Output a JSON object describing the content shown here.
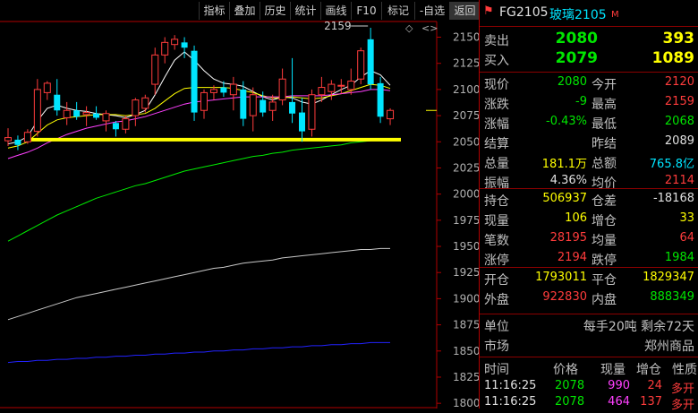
{
  "toolbar": {
    "buttons": [
      "指标",
      "叠加",
      "历史",
      "统计",
      "画线",
      "F10",
      "标记",
      "-自选",
      "返回"
    ]
  },
  "chart_data": {
    "type": "candlestick",
    "ylim": [
      1795,
      2165
    ],
    "y_ticks": [
      2150,
      2125,
      2100,
      2075,
      2050,
      2025,
      2000,
      1975,
      1950,
      1925,
      1900,
      1875,
      1850,
      1825,
      1800
    ],
    "candles": [
      {
        "o": 2051,
        "h": 2063,
        "l": 2046,
        "c": 2054,
        "dir": "up"
      },
      {
        "o": 2052,
        "h": 2056,
        "l": 2042,
        "c": 2047,
        "dir": "down"
      },
      {
        "o": 2050,
        "h": 2062,
        "l": 2048,
        "c": 2059,
        "dir": "up"
      },
      {
        "o": 2060,
        "h": 2110,
        "l": 2055,
        "c": 2100,
        "dir": "up"
      },
      {
        "o": 2097,
        "h": 2108,
        "l": 2090,
        "c": 2106,
        "dir": "up"
      },
      {
        "o": 2095,
        "h": 2110,
        "l": 2075,
        "c": 2080,
        "dir": "down"
      },
      {
        "o": 2073,
        "h": 2088,
        "l": 2066,
        "c": 2080,
        "dir": "up"
      },
      {
        "o": 2080,
        "h": 2088,
        "l": 2071,
        "c": 2074,
        "dir": "down"
      },
      {
        "o": 2076,
        "h": 2084,
        "l": 2065,
        "c": 2078,
        "dir": "up"
      },
      {
        "o": 2077,
        "h": 2084,
        "l": 2071,
        "c": 2073,
        "dir": "down"
      },
      {
        "o": 2070,
        "h": 2080,
        "l": 2060,
        "c": 2077,
        "dir": "up"
      },
      {
        "o": 2062,
        "h": 2070,
        "l": 2055,
        "c": 2068,
        "dir": "down"
      },
      {
        "o": 2062,
        "h": 2075,
        "l": 2058,
        "c": 2072,
        "dir": "up"
      },
      {
        "o": 2075,
        "h": 2092,
        "l": 2065,
        "c": 2090,
        "dir": "up"
      },
      {
        "o": 2082,
        "h": 2095,
        "l": 2078,
        "c": 2092,
        "dir": "up"
      },
      {
        "o": 2105,
        "h": 2140,
        "l": 2095,
        "c": 2133,
        "dir": "up"
      },
      {
        "o": 2133,
        "h": 2150,
        "l": 2125,
        "c": 2145,
        "dir": "up"
      },
      {
        "o": 2143,
        "h": 2152,
        "l": 2138,
        "c": 2148,
        "dir": "up"
      },
      {
        "o": 2145,
        "h": 2150,
        "l": 2130,
        "c": 2140,
        "dir": "down"
      },
      {
        "o": 2137,
        "h": 2142,
        "l": 2070,
        "c": 2078,
        "dir": "down"
      },
      {
        "o": 2080,
        "h": 2100,
        "l": 2072,
        "c": 2097,
        "dir": "up"
      },
      {
        "o": 2097,
        "h": 2104,
        "l": 2090,
        "c": 2100,
        "dir": "up"
      },
      {
        "o": 2102,
        "h": 2108,
        "l": 2093,
        "c": 2097,
        "dir": "down"
      },
      {
        "o": 2095,
        "h": 2112,
        "l": 2080,
        "c": 2105,
        "dir": "up"
      },
      {
        "o": 2100,
        "h": 2108,
        "l": 2065,
        "c": 2072,
        "dir": "down"
      },
      {
        "o": 2075,
        "h": 2102,
        "l": 2060,
        "c": 2095,
        "dir": "up"
      },
      {
        "o": 2090,
        "h": 2098,
        "l": 2074,
        "c": 2078,
        "dir": "down"
      },
      {
        "o": 2080,
        "h": 2095,
        "l": 2070,
        "c": 2088,
        "dir": "up"
      },
      {
        "o": 2090,
        "h": 2120,
        "l": 2085,
        "c": 2110,
        "dir": "up"
      },
      {
        "o": 2088,
        "h": 2130,
        "l": 2068,
        "c": 2077,
        "dir": "down"
      },
      {
        "o": 2078,
        "h": 2092,
        "l": 2050,
        "c": 2060,
        "dir": "down"
      },
      {
        "o": 2062,
        "h": 2100,
        "l": 2055,
        "c": 2095,
        "dir": "up"
      },
      {
        "o": 2095,
        "h": 2112,
        "l": 2088,
        "c": 2102,
        "dir": "up"
      },
      {
        "o": 2098,
        "h": 2109,
        "l": 2090,
        "c": 2105,
        "dir": "up"
      },
      {
        "o": 2104,
        "h": 2110,
        "l": 2096,
        "c": 2104,
        "dir": "up"
      },
      {
        "o": 2100,
        "h": 2120,
        "l": 2095,
        "c": 2108,
        "dir": "up"
      },
      {
        "o": 2110,
        "h": 2140,
        "l": 2105,
        "c": 2137,
        "dir": "up"
      },
      {
        "o": 2148,
        "h": 2159,
        "l": 2100,
        "c": 2105,
        "dir": "down"
      },
      {
        "o": 2106,
        "h": 2112,
        "l": 2068,
        "c": 2074,
        "dir": "down"
      },
      {
        "o": 2072,
        "h": 2082,
        "l": 2066,
        "c": 2080,
        "dir": "up"
      }
    ],
    "ma_lines": [
      {
        "name": "ma-white",
        "color": "#ffffff",
        "values": [
          2048,
          2050,
          2055,
          2070,
          2082,
          2085,
          2082,
          2080,
          2079,
          2077,
          2076,
          2075,
          2073,
          2076,
          2080,
          2095,
          2112,
          2128,
          2136,
          2128,
          2118,
          2110,
          2106,
          2105,
          2103,
          2098,
          2093,
          2090,
          2093,
          2092,
          2088,
          2086,
          2090,
          2095,
          2100,
          2104,
          2112,
          2118,
          2114,
          2104
        ]
      },
      {
        "name": "ma-yellow",
        "color": "#ffff00",
        "values": [
          2044,
          2046,
          2050,
          2058,
          2066,
          2071,
          2073,
          2074,
          2075,
          2076,
          2076,
          2076,
          2075,
          2076,
          2077,
          2082,
          2089,
          2096,
          2101,
          2102,
          2102,
          2102,
          2102,
          2101,
          2099,
          2097,
          2094,
          2092,
          2092,
          2093,
          2092,
          2091,
          2092,
          2094,
          2096,
          2099,
          2102,
          2105,
          2104,
          2101
        ]
      },
      {
        "name": "ma-magenta",
        "color": "#ff40ff",
        "values": [
          2034,
          2037,
          2040,
          2044,
          2049,
          2053,
          2057,
          2060,
          2063,
          2065,
          2067,
          2069,
          2070,
          2072,
          2074,
          2077,
          2080,
          2083,
          2086,
          2088,
          2089,
          2090,
          2091,
          2092,
          2093,
          2093,
          2093,
          2093,
          2093,
          2094,
          2094,
          2094,
          2094,
          2095,
          2096,
          2097,
          2098,
          2100,
          2100,
          2099
        ]
      },
      {
        "name": "ma-green",
        "color": "#00ee00",
        "values": [
          1955,
          1960,
          1965,
          1970,
          1975,
          1980,
          1984,
          1988,
          1992,
          1996,
          1999,
          2002,
          2005,
          2008,
          2010,
          2013,
          2016,
          2019,
          2022,
          2024,
          2026,
          2028,
          2030,
          2032,
          2034,
          2036,
          2037,
          2039,
          2040,
          2042,
          2043,
          2044,
          2045,
          2046,
          2047,
          2049,
          2050,
          2051,
          2052,
          2052
        ]
      },
      {
        "name": "ma-gray",
        "color": "#c8c8c8",
        "values": [
          1880,
          1883,
          1886,
          1889,
          1892,
          1895,
          1898,
          1901,
          1903,
          1905,
          1907,
          1909,
          1911,
          1913,
          1915,
          1917,
          1919,
          1921,
          1923,
          1925,
          1927,
          1929,
          1930,
          1932,
          1934,
          1935,
          1936,
          1937,
          1939,
          1940,
          1941,
          1942,
          1943,
          1944,
          1945,
          1946,
          1947,
          1947,
          1948,
          1948
        ]
      },
      {
        "name": "ma-blue",
        "color": "#2222ff",
        "values": [
          1839,
          1840,
          1840,
          1841,
          1841,
          1842,
          1842,
          1843,
          1843,
          1844,
          1844,
          1845,
          1845,
          1846,
          1846,
          1847,
          1847,
          1848,
          1848,
          1849,
          1849,
          1850,
          1850,
          1851,
          1851,
          1852,
          1852,
          1853,
          1853,
          1854,
          1854,
          1855,
          1855,
          1856,
          1856,
          1857,
          1857,
          1858,
          1858,
          1858
        ]
      }
    ],
    "support_line_value": 2052,
    "high_annotation": {
      "label": "2159",
      "value": 2159
    },
    "last_price_marker": 2080
  },
  "panel": {
    "code": "FG2105",
    "name": "玻璃2105",
    "suffix": "M",
    "sell": {
      "label": "卖出",
      "price": "2080",
      "vol": "393"
    },
    "buy": {
      "label": "买入",
      "price": "2079",
      "vol": "1089"
    },
    "rows1": [
      {
        "l1": "现价",
        "v1": "2080",
        "c1": "green",
        "l2": "今开",
        "v2": "2120",
        "c2": "red"
      },
      {
        "l1": "涨跌",
        "v1": "-9",
        "c1": "green",
        "l2": "最高",
        "v2": "2159",
        "c2": "red"
      },
      {
        "l1": "涨幅",
        "v1": "-0.43%",
        "c1": "green",
        "l2": "最低",
        "v2": "2068",
        "c2": "green"
      },
      {
        "l1": "结算",
        "v1": "",
        "c1": "white",
        "l2": "昨结",
        "v2": "2089",
        "c2": "white"
      },
      {
        "l1": "总量",
        "v1": "181.1万",
        "c1": "yellow",
        "l2": "总额",
        "v2": "765.8亿",
        "c2": "cyan"
      },
      {
        "l1": "振幅",
        "v1": "4.36%",
        "c1": "white",
        "l2": "均价",
        "v2": "2114",
        "c2": "red"
      }
    ],
    "rows2": [
      {
        "l1": "持仓",
        "v1": "506937",
        "c1": "yellow",
        "l2": "仓差",
        "v2": "-18168",
        "c2": "white"
      },
      {
        "l1": "现量",
        "v1": "106",
        "c1": "yellow",
        "l2": "增仓",
        "v2": "33",
        "c2": "yellow"
      },
      {
        "l1": "笔数",
        "v1": "28195",
        "c1": "red",
        "l2": "均量",
        "v2": "64",
        "c2": "red"
      },
      {
        "l1": "涨停",
        "v1": "2194",
        "c1": "red",
        "l2": "跌停",
        "v2": "1984",
        "c2": "green"
      }
    ],
    "rows3": [
      {
        "l1": "开仓",
        "v1": "1793011",
        "c1": "yellow",
        "l2": "平仓",
        "v2": "1829347",
        "c2": "yellow"
      },
      {
        "l1": "外盘",
        "v1": "922830",
        "c1": "red",
        "l2": "内盘",
        "v2": "888349",
        "c2": "green"
      }
    ],
    "unit": {
      "label": "单位",
      "value": "每手20吨 剩余72天"
    },
    "market": {
      "label": "市场",
      "value": "郑州商品"
    },
    "ticks_header": [
      "时间",
      "价格",
      "现量",
      "增仓",
      "性质"
    ],
    "ticks": [
      {
        "time": "11:16:25",
        "price": "2078",
        "vol": "990",
        "oi": "24",
        "nature": "多开"
      },
      {
        "time": "11:16:25",
        "price": "2078",
        "vol": "464",
        "oi": "137",
        "nature": "多开"
      }
    ]
  }
}
